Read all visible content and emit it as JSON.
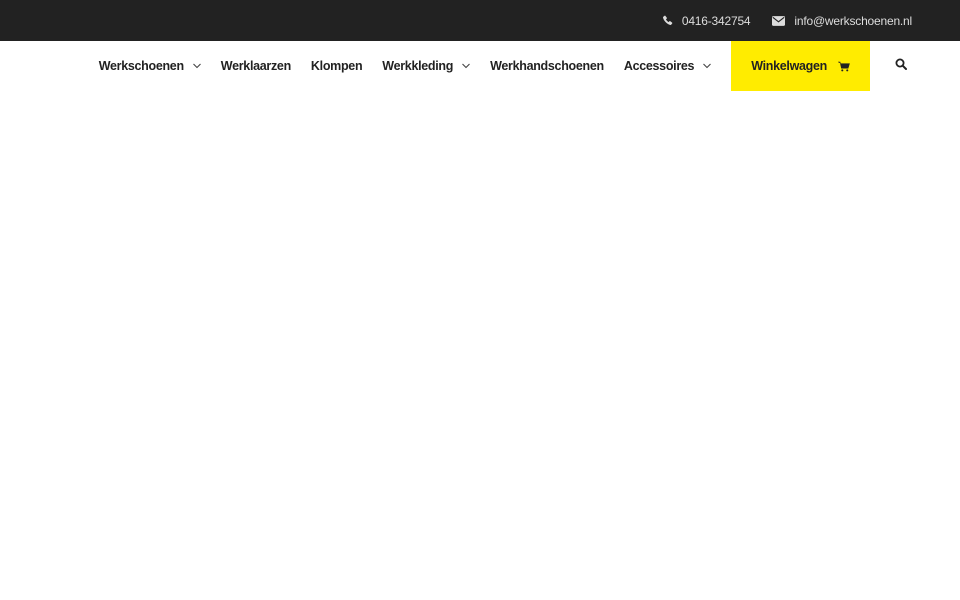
{
  "topbar": {
    "phone": {
      "icon": "phone-icon",
      "label": "0416-342754"
    },
    "email": {
      "icon": "envelope-icon",
      "label": "info@werkschoenen.nl"
    }
  },
  "nav": {
    "items": [
      {
        "label": "Werkschoenen",
        "has_dropdown": true
      },
      {
        "label": "Werklaarzen",
        "has_dropdown": false
      },
      {
        "label": "Klompen",
        "has_dropdown": false
      },
      {
        "label": "Werkkleding",
        "has_dropdown": true
      },
      {
        "label": "Werkhandschoenen",
        "has_dropdown": false
      },
      {
        "label": "Accessoires",
        "has_dropdown": true
      }
    ],
    "cart": {
      "label": "Winkelwagen",
      "icon": "shopping-cart-icon"
    },
    "search": {
      "icon": "search-icon"
    }
  },
  "colors": {
    "topbar_bg": "#222222",
    "accent": "#ffec00",
    "text": "#222222"
  }
}
